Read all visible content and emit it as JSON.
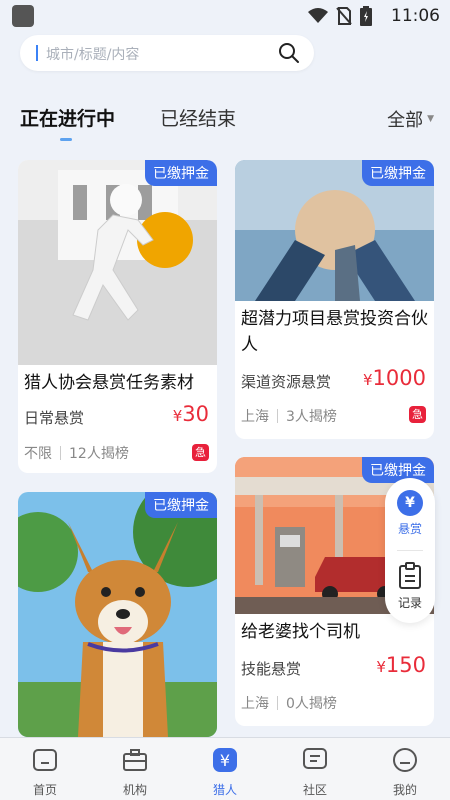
{
  "status": {
    "time": "11:06"
  },
  "search": {
    "placeholder": "城市/标题/内容"
  },
  "tabs": {
    "active": "正在进行中",
    "inactive": "已经结束",
    "filter": "全部"
  },
  "cards": [
    {
      "badge": "已缴押金",
      "title": "猎人协会悬赏任务素材",
      "category": "日常悬赏",
      "currency": "¥",
      "price": "30",
      "location": "不限",
      "count": "12人揭榜",
      "urgent": "急"
    },
    {
      "badge": "已缴押金",
      "title": "超潜力项目悬赏投资合伙人",
      "category": "渠道资源悬赏",
      "currency": "¥",
      "price": "1000",
      "location": "上海",
      "count": "3人揭榜",
      "urgent": "急"
    },
    {
      "badge": "已缴押金",
      "title": "给老婆找个司机",
      "category": "技能悬赏",
      "currency": "¥",
      "price": "150",
      "location": "上海",
      "count": "0人揭榜"
    },
    {
      "badge": "已缴押金"
    }
  ],
  "float": {
    "reward_icon": "¥",
    "reward_label": "悬赏",
    "record_label": "记录"
  },
  "nav": {
    "items": [
      {
        "label": "首页",
        "icon": "home-icon"
      },
      {
        "label": "机构",
        "icon": "briefcase-icon"
      },
      {
        "label": "猎人",
        "icon": "yen-icon"
      },
      {
        "label": "社区",
        "icon": "chat-icon"
      },
      {
        "label": "我的",
        "icon": "user-icon"
      }
    ],
    "active_label": "猎人",
    "accent": "#3d6fe8"
  }
}
